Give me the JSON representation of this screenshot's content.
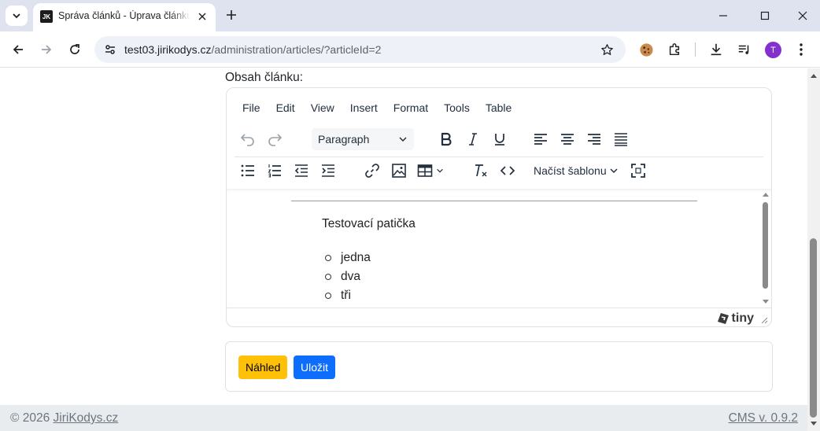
{
  "browser": {
    "tab_title": "Správa článků - Úprava článku",
    "tab_favicon": "JK",
    "url_host": "test03.jirikodys.cz",
    "url_path": "/administration/articles/?articleId=2",
    "avatar_letter": "T",
    "avatar_color": "#8430ce"
  },
  "form": {
    "content_label": "Obsah článku:"
  },
  "editor": {
    "menu": [
      "File",
      "Edit",
      "View",
      "Insert",
      "Format",
      "Tools",
      "Table"
    ],
    "block_format": "Paragraph",
    "template_dropdown": "Načíst šablonu",
    "footer_text": "Testovací patička",
    "list_items": [
      "jedna",
      "dva",
      "tři"
    ],
    "brand": "tiny"
  },
  "actions": {
    "preview_label": "Náhled",
    "save_label": "Uložit",
    "preview_color": "#ffc107",
    "save_color": "#0d6efd"
  },
  "footer": {
    "copyright_prefix": "© 2026 ",
    "copyright_link": "JiriKodys.cz",
    "version": "CMS v. 0.9.2"
  }
}
